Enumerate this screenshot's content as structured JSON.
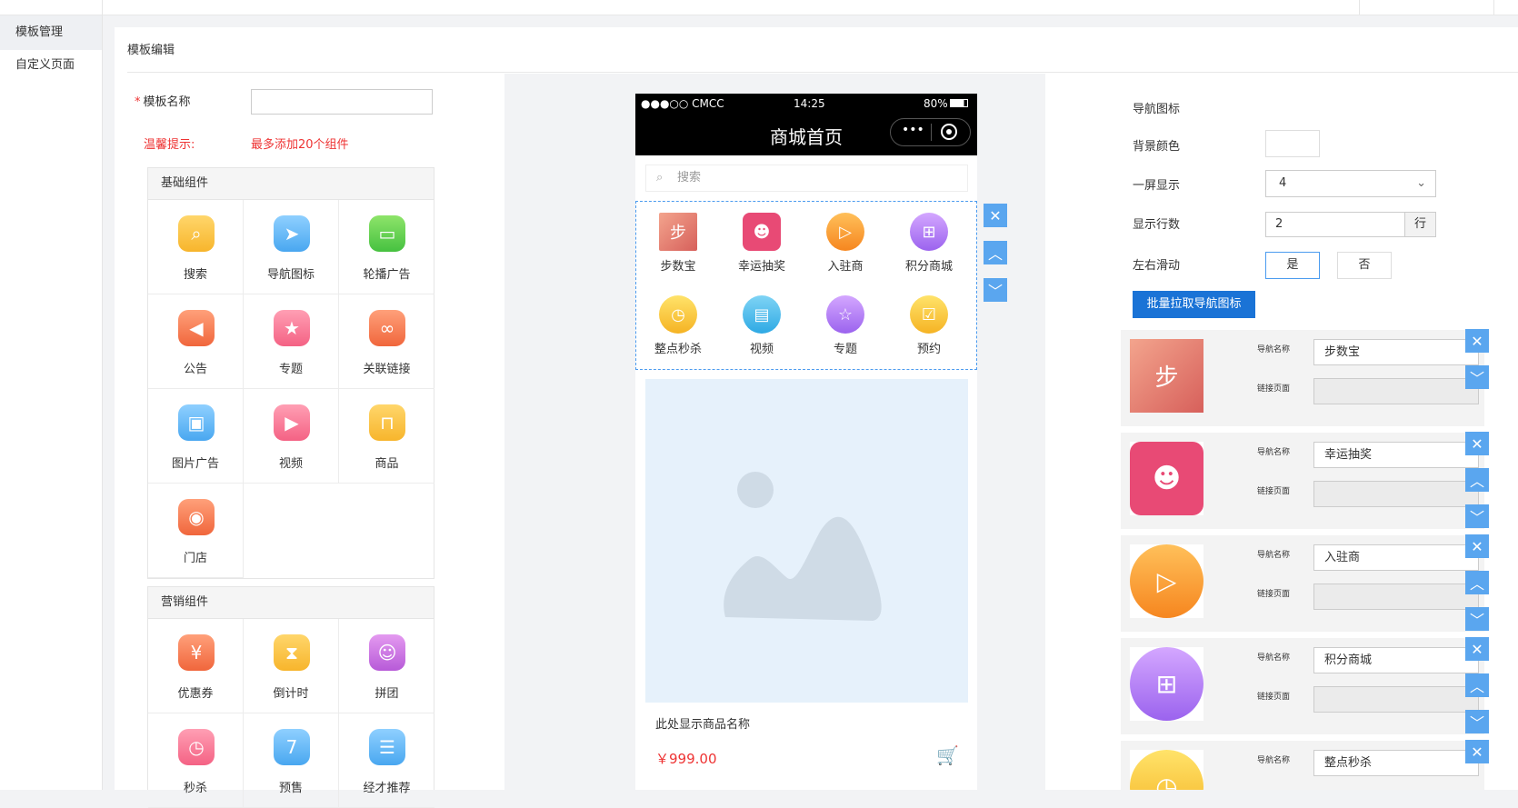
{
  "side_menu": {
    "items": [
      "模板管理",
      "自定义页面"
    ]
  },
  "breadcrumb": "模板编辑",
  "form": {
    "name_label": "模板名称",
    "name_value": "",
    "tip_label": "温馨提示:",
    "tip_text": "最多添加20个组件"
  },
  "basic_components": {
    "title": "基础组件",
    "items": [
      "搜索",
      "导航图标",
      "轮播广告",
      "公告",
      "专题",
      "关联链接",
      "图片广告",
      "视频",
      "商品",
      "门店"
    ]
  },
  "marketing_components": {
    "title": "营销组件",
    "items": [
      "优惠券",
      "倒计时",
      "拼团",
      "秒杀",
      "预售",
      "经才推荐"
    ]
  },
  "phone": {
    "carrier": "●●●○○ CMCC",
    "time": "14:25",
    "battery": "80%",
    "title": "商城首页",
    "search_placeholder": "搜索",
    "nav_items": [
      "步数宝",
      "幸运抽奖",
      "入驻商",
      "积分商城",
      "整点秒杀",
      "视频",
      "专题",
      "预约"
    ],
    "product_name": "此处显示商品名称",
    "product_price": "￥999.00"
  },
  "editor": {
    "title": "导航图标",
    "bg_color_label": "背景颜色",
    "per_screen_label": "一屏显示",
    "per_screen_value": "4",
    "rows_label": "显示行数",
    "rows_value": "2",
    "rows_unit": "行",
    "swipe_label": "左右滑动",
    "swipe_yes": "是",
    "swipe_no": "否",
    "batch_button": "批量拉取导航图标",
    "name_field_label": "导航名称",
    "link_field_label": "链接页面",
    "cards": [
      "步数宝",
      "幸运抽奖",
      "入驻商",
      "积分商城",
      "整点秒杀"
    ]
  },
  "colors": {
    "accent": "#1a73d6",
    "control_blue": "#5aa6ef",
    "warning_red": "#e33333"
  }
}
